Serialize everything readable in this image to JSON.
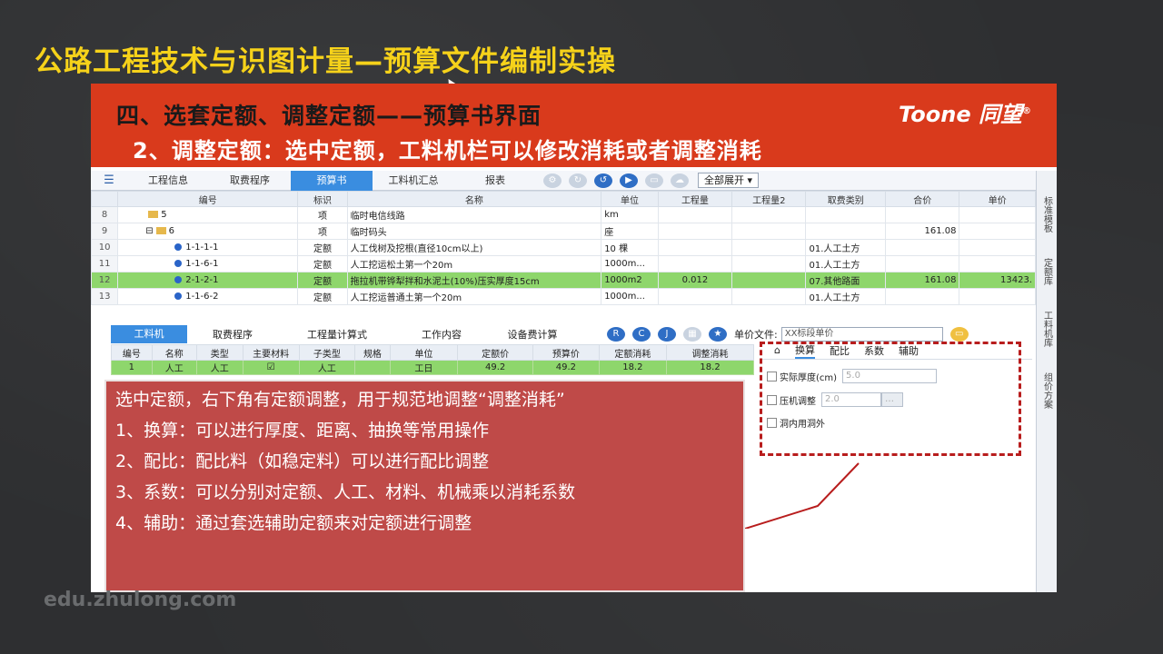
{
  "page": {
    "title": "公路工程技术与识图计量—预算文件编制实操",
    "watermark": "edu.zhulong.com"
  },
  "slide": {
    "heading": "四、选套定额、调整定额——预算书界面",
    "subheading": "2、调整定额：选中定额，工料机栏可以修改消耗或者调整消耗",
    "logo_text": "Toone",
    "logo_cn": "同望",
    "logo_mark": "®"
  },
  "toolbar": {
    "tabs": [
      "工程信息",
      "取费程序",
      "预算书",
      "工料机汇总",
      "报表"
    ],
    "active_tab": "预算书",
    "expand_label": "全部展开"
  },
  "main_grid": {
    "headers": [
      "编号",
      "标识",
      "名称",
      "单位",
      "工程量",
      "工程量2",
      "取费类别",
      "合价",
      "单价"
    ],
    "rows": [
      {
        "n": "8",
        "code": "5",
        "tag": "项",
        "name": "临时电信线路",
        "unit": "km",
        "q": "",
        "q2": "",
        "cat": "",
        "total": "",
        "price": "",
        "type": "folder"
      },
      {
        "n": "9",
        "code": "6",
        "tag": "项",
        "name": "临时码头",
        "unit": "座",
        "q": "",
        "q2": "",
        "cat": "",
        "total": "161.08",
        "price": "",
        "type": "folder-open"
      },
      {
        "n": "10",
        "code": "1-1-1-1",
        "tag": "定额",
        "name": "人工伐树及挖根(直径10cm以上)",
        "unit": "10 棵",
        "q": "",
        "q2": "",
        "cat": "01.人工土方",
        "total": "",
        "price": "",
        "type": "dot"
      },
      {
        "n": "11",
        "code": "1-1-6-1",
        "tag": "定额",
        "name": "人工挖运松土第一个20m",
        "unit": "1000m...",
        "q": "",
        "q2": "",
        "cat": "01.人工土方",
        "total": "",
        "price": "",
        "type": "dot"
      },
      {
        "n": "12",
        "code": "2-1-2-1",
        "tag": "定额",
        "name": "拖拉机带铧犁拌和水泥土(10%)压实厚度15cm",
        "unit": "1000m2",
        "q": "0.012",
        "q2": "",
        "cat": "07.其他路面",
        "total": "161.08",
        "price": "13423.",
        "type": "dot",
        "selected": true
      },
      {
        "n": "13",
        "code": "1-1-6-2",
        "tag": "定额",
        "name": "人工挖运普通土第一个20m",
        "unit": "1000m...",
        "q": "",
        "q2": "",
        "cat": "01.人工土方",
        "total": "",
        "price": "",
        "type": "dot"
      }
    ]
  },
  "side_tabs": [
    "标准模板",
    "定额库",
    "工料机库",
    "组价方案"
  ],
  "bottom": {
    "tabs": [
      "工料机",
      "取费程序",
      "工程量计算式",
      "工作内容",
      "设备费计算"
    ],
    "active_tab": "工料机",
    "unit_file_label": "单价文件:",
    "unit_file_value": "XX标段单价",
    "headers": [
      "编号",
      "名称",
      "类型",
      "主要材料",
      "子类型",
      "规格",
      "单位",
      "定额价",
      "预算价",
      "定额消耗",
      "调整消耗"
    ],
    "row": [
      "1",
      "人工",
      "人工",
      "☑",
      "人工",
      "",
      "工日",
      "49.2",
      "49.2",
      "18.2",
      "18.2"
    ]
  },
  "adjust_panel": {
    "tabs": [
      "换算",
      "配比",
      "系数",
      "辅助"
    ],
    "active_tab": "换算",
    "options": [
      {
        "label": "实际厚度(cm)",
        "value": "5.0"
      },
      {
        "label": "压机调整",
        "value": "2.0"
      },
      {
        "label": "洞内用洞外",
        "value": ""
      }
    ]
  },
  "callout": {
    "intro": "选中定额，右下角有定额调整，用于规范地调整“调整消耗”",
    "items": [
      "1、换算：可以进行厚度、距离、抽换等常用操作",
      "2、配比：配比料（如稳定料）可以进行配比调整",
      "3、系数：可以分别对定额、人工、材料、机械乘以消耗系数",
      "4、辅助：通过套选辅助定额来对定额进行调整"
    ]
  }
}
